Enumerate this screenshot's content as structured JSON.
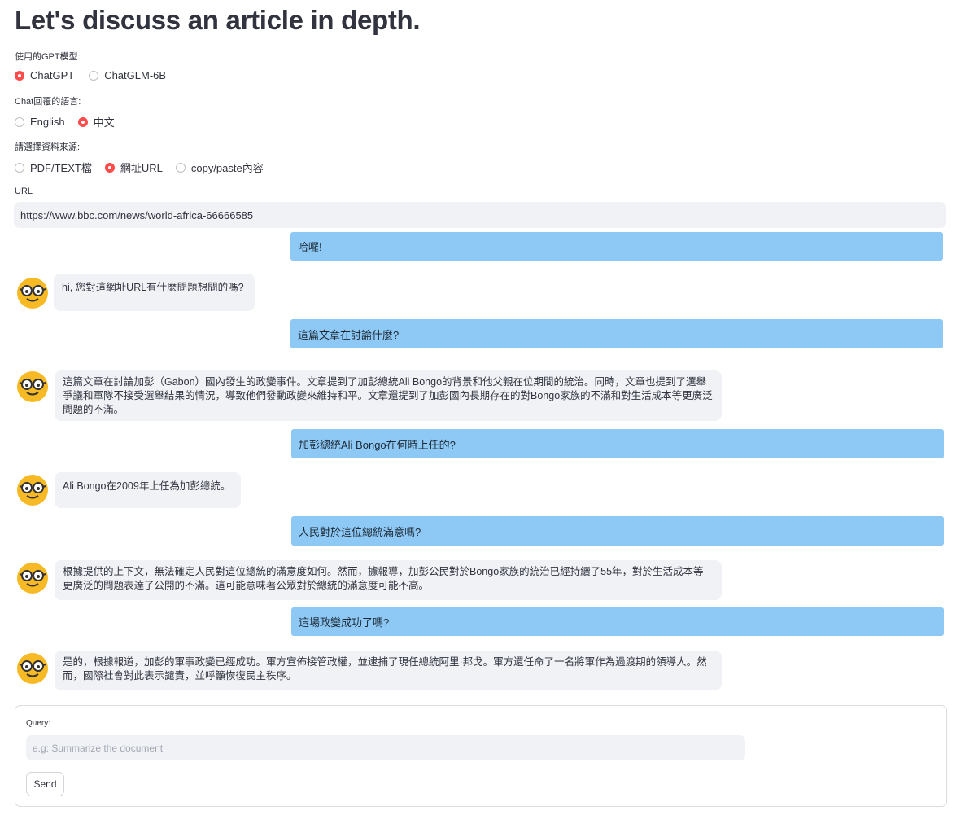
{
  "page": {
    "title": "Let's discuss an article in depth."
  },
  "model_group": {
    "label": "使用的GPT模型:",
    "options": [
      {
        "label": "ChatGPT",
        "selected": true
      },
      {
        "label": "ChatGLM-6B",
        "selected": false
      }
    ]
  },
  "language_group": {
    "label": "Chat回覆的語言:",
    "options": [
      {
        "label": "English",
        "selected": false
      },
      {
        "label": "中文",
        "selected": true
      }
    ]
  },
  "source_group": {
    "label": "請選擇資料來源:",
    "options": [
      {
        "label": "PDF/TEXT檔",
        "selected": false
      },
      {
        "label": "網址URL",
        "selected": true
      },
      {
        "label": "copy/paste內容",
        "selected": false
      }
    ]
  },
  "url_field": {
    "label": "URL",
    "value": "https://www.bbc.com/news/world-africa-66666585"
  },
  "chat": [
    {
      "role": "user",
      "text": "哈囉!"
    },
    {
      "role": "bot",
      "text": "hi, 您對這網址URL有什麼問題想問的嗎?"
    },
    {
      "role": "user",
      "text": "這篇文章在討論什麼?"
    },
    {
      "role": "bot",
      "text": "這篇文章在討論加彭（Gabon）國內發生的政變事件。文章提到了加彭總統Ali Bongo的背景和他父親在位期間的統治。同時，文章也提到了選舉爭議和軍隊不接受選舉結果的情況，導致他們發動政變來維持和平。文章還提到了加彭國內長期存在的對Bongo家族的不滿和對生活成本等更廣泛問題的不滿。"
    },
    {
      "role": "user",
      "text": "加彭總統Ali Bongo在何時上任的?"
    },
    {
      "role": "bot",
      "text": "Ali Bongo在2009年上任為加彭總統。"
    },
    {
      "role": "user",
      "text": "人民對於這位總統滿意嗎?"
    },
    {
      "role": "bot",
      "text": "根據提供的上下文，無法確定人民對這位總統的滿意度如何。然而，據報導，加彭公民對於Bongo家族的統治已經持續了55年，對於生活成本等更廣泛的問題表達了公開的不滿。這可能意味著公眾對於總統的滿意度可能不高。"
    },
    {
      "role": "user",
      "text": "這場政變成功了嗎?"
    },
    {
      "role": "bot",
      "text": "是的，根據報道，加彭的軍事政變已經成功。軍方宣佈接管政權，並逮捕了現任總統阿里·邦戈。軍方還任命了一名將軍作為過渡期的領導人。然而，國際社會對此表示譴責，並呼籲恢復民主秩序。"
    }
  ],
  "query": {
    "label": "Query:",
    "placeholder": "e.g: Summarize the document",
    "send_label": "Send"
  },
  "colors": {
    "accent": "#ff4b4b",
    "user_bubble": "#8ec9f5",
    "bot_bubble": "#f0f2f6",
    "avatar": "#f7b924"
  }
}
